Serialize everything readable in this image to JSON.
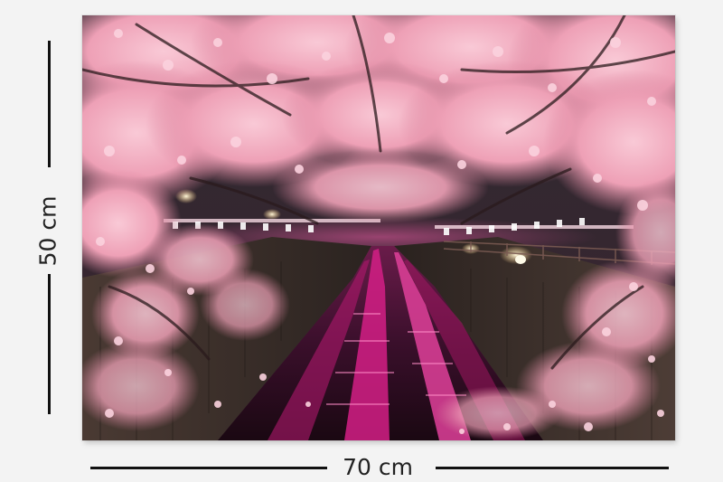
{
  "product": {
    "height_label": "50 cm",
    "width_label": "70 cm"
  },
  "colors": {
    "background": "#f3f3f3",
    "blossom": "#f2b3c3",
    "water_glow": "#e8208a",
    "night": "#1b1418"
  }
}
